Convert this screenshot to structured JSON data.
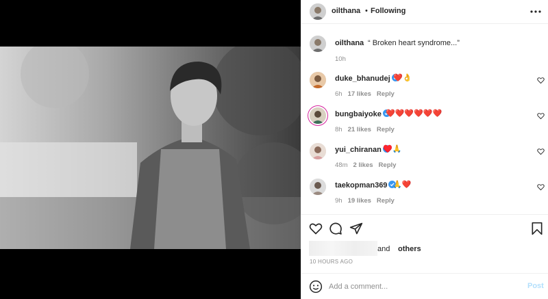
{
  "post": {
    "owner": "oilthana",
    "separator": "•",
    "follow_state": "Following",
    "caption_user": "oilthana",
    "caption_text": "“ Broken heart syndrome...”",
    "caption_time": "10h",
    "icons": {
      "more": "more-icon",
      "like": "heart-icon",
      "comment": "comment-icon",
      "share": "share-icon",
      "save": "bookmark-icon",
      "emoji": "smile-icon",
      "verified": "verified-badge-icon"
    }
  },
  "comments": [
    {
      "user": "duke_bhanudej",
      "verified": true,
      "text": "❤️👌",
      "time": "6h",
      "likes": "17 likes",
      "reply": "Reply"
    },
    {
      "user": "bungbaiyoke",
      "verified": true,
      "text": "❤️❤️❤️❤️❤️❤️",
      "time": "8h",
      "likes": "21 likes",
      "reply": "Reply"
    },
    {
      "user": "yui_chiranan",
      "verified": true,
      "text": "♥️🙏",
      "time": "48m",
      "likes": "2 likes",
      "reply": "Reply"
    },
    {
      "user": "taekopman369",
      "verified": true,
      "text": "🙏❤️",
      "time": "9h",
      "likes": "19 likes",
      "reply": "Reply"
    }
  ],
  "likes": {
    "and": "and",
    "others": "others"
  },
  "timeago": "10 HOURS AGO",
  "add_comment": {
    "placeholder": "Add a comment...",
    "post_label": "Post"
  },
  "colors": {
    "accent": "#0095f6",
    "post_disabled": "#b2dffc",
    "heart_red": "#ed4956",
    "verified": "#3897f0"
  }
}
